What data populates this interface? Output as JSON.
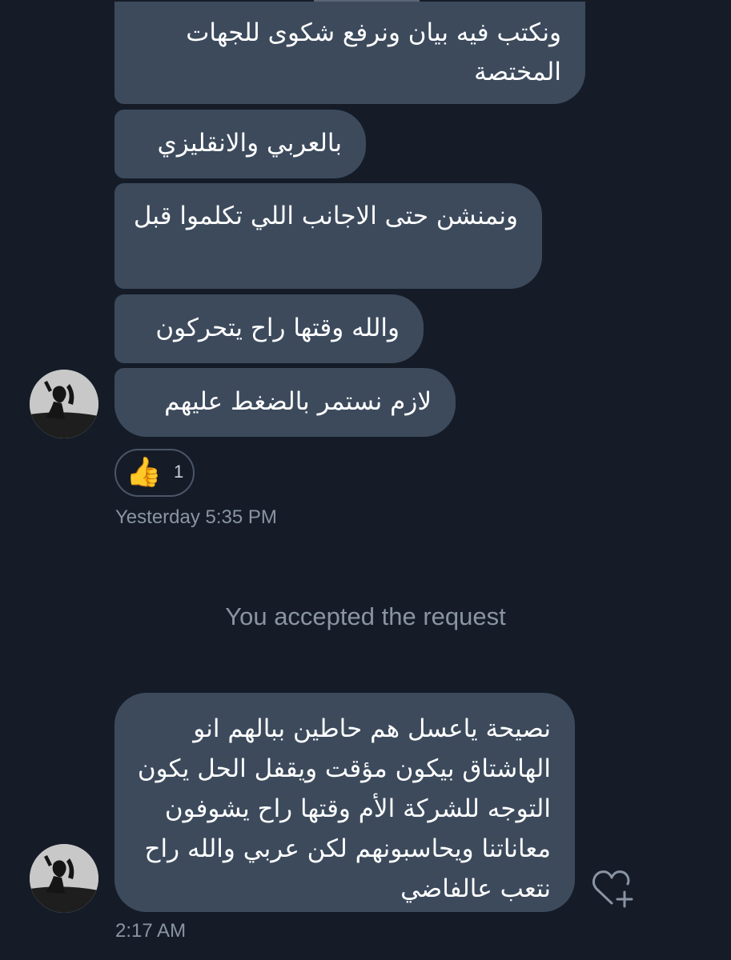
{
  "messages": [
    {
      "text": "ونكتب فيه بيان ونرفع شكوى للجهات المختصة"
    },
    {
      "text": "بالعربي والانقليزي"
    },
    {
      "text": "ونمنشن حتى الاجانب اللي تكلموا قبل"
    },
    {
      "text": "والله وقتها راح يتحركون"
    },
    {
      "text": "لازم نستمر بالضغط عليهم"
    }
  ],
  "reaction": {
    "icon": "thumbs-up-icon",
    "count": "1"
  },
  "timestamps": {
    "first": "Yesterday 5:35 PM",
    "second": "2:17 AM"
  },
  "system_message": "You accepted the request",
  "last_message": {
    "text": "نصيحة ياعسل هم حاطين ببالهم انو الهاشتاق بيكون مؤقت ويقفل الحل يكون التوجه للشركة الأم  وقتها راح يشوفون معاناتنا ويحاسبونهم لكن عربي والله راح نتعب عالفاضي"
  },
  "colors": {
    "background": "#151c27",
    "bubble": "#3c4a5c",
    "muted_text": "#8a94a3"
  }
}
